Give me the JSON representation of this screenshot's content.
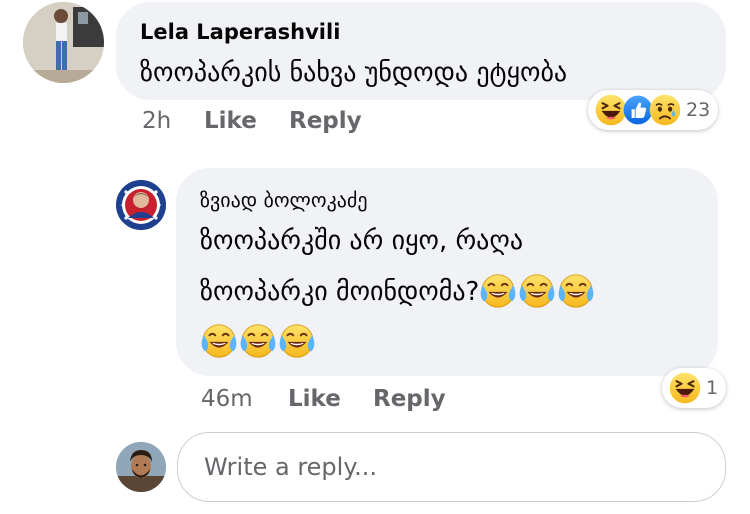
{
  "comments": [
    {
      "author": "Lela Laperashvili",
      "text": "ზოოპარკის ნახვა უნდოდა ეტყობა",
      "time": "2h",
      "like_label": "Like",
      "reply_label": "Reply",
      "reaction_icons": [
        "haha-icon",
        "like-icon",
        "sad-icon"
      ],
      "reaction_count": "23"
    },
    {
      "author": "ზვიად ბოლოკაძე",
      "text_line1": "ზოოპარკში არ იყო, რაღა",
      "text_line2": "ზოოპარკი მოინდომა?",
      "line2_emoji_count": 3,
      "line3_emoji_count": 3,
      "emoji_icon": "tears-of-joy-emoji",
      "time": "46m",
      "like_label": "Like",
      "reply_label": "Reply",
      "reaction_icons": [
        "haha-icon"
      ],
      "reaction_count": "1"
    }
  ],
  "reply_box": {
    "placeholder": "Write a reply..."
  },
  "colors": {
    "bubble": "#f0f2f5",
    "meta_text": "#65676b",
    "like_blue": "#1877f2",
    "emoji_yellow": "#fcc21b"
  }
}
